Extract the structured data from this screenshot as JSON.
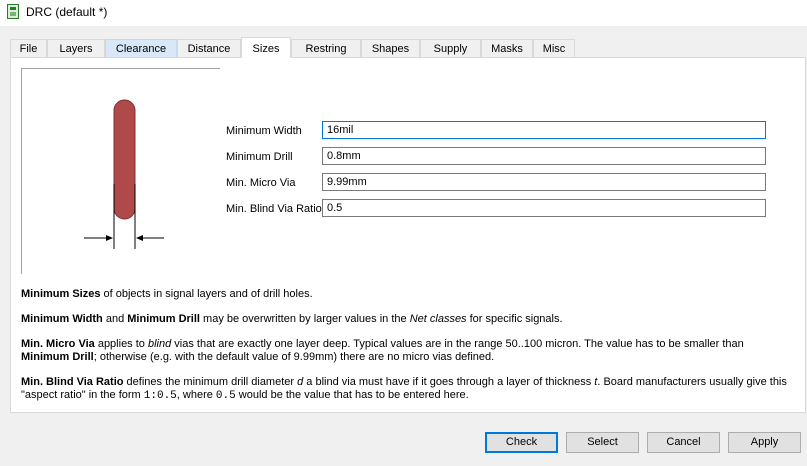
{
  "window": {
    "title": "DRC (default *)"
  },
  "tabs": [
    {
      "label": "File"
    },
    {
      "label": "Layers"
    },
    {
      "label": "Clearance"
    },
    {
      "label": "Distance"
    },
    {
      "label": "Sizes"
    },
    {
      "label": "Restring"
    },
    {
      "label": "Shapes"
    },
    {
      "label": "Supply"
    },
    {
      "label": "Masks"
    },
    {
      "label": "Misc"
    }
  ],
  "active_tab": "Sizes",
  "fields": [
    {
      "label": "Minimum Width",
      "value": "16mil"
    },
    {
      "label": "Minimum Drill",
      "value": "0.8mm"
    },
    {
      "label": "Min. Micro Via",
      "value": "9.99mm"
    },
    {
      "label": "Min. Blind Via Ratio",
      "value": "0.5"
    }
  ],
  "help": {
    "p1_bold": "Minimum Sizes",
    "p1_rest": " of objects in signal layers and of drill holes.",
    "p2_bold1": "Minimum Width",
    "p2_and": " and ",
    "p2_bold2": "Minimum Drill",
    "p2_mid": " may be overwritten by larger values in the ",
    "p2_italic": "Net classes",
    "p2_end": " for specific signals.",
    "p3_bold1": "Min. Micro Via",
    "p3_a": " applies to ",
    "p3_italic": "blind",
    "p3_b": " vias that are exactly one layer deep. Typical values are in the range 50..100 micron. The value has to be smaller than ",
    "p3_bold2": "Minimum Drill",
    "p3_c": "; otherwise (e.g. with the default value of 9.99mm) there are no micro vias defined.",
    "p4_bold": "Min. Blind Via Ratio",
    "p4_a": " defines the minimum drill diameter ",
    "p4_it1": "d",
    "p4_b": " a blind via must have if it goes through a layer of thickness ",
    "p4_it2": "t",
    "p4_c": ". Board manufacturers usually give this \"aspect ratio\" in the form ",
    "p4_code1": "1:0.5",
    "p4_d": ", where ",
    "p4_code2": "0.5",
    "p4_e": " would be the value that has to be entered here."
  },
  "buttons": {
    "check": "Check",
    "select": "Select",
    "cancel": "Cancel",
    "apply": "Apply"
  },
  "colors": {
    "trace": "#b04a4a",
    "focus": "#0078d7"
  }
}
